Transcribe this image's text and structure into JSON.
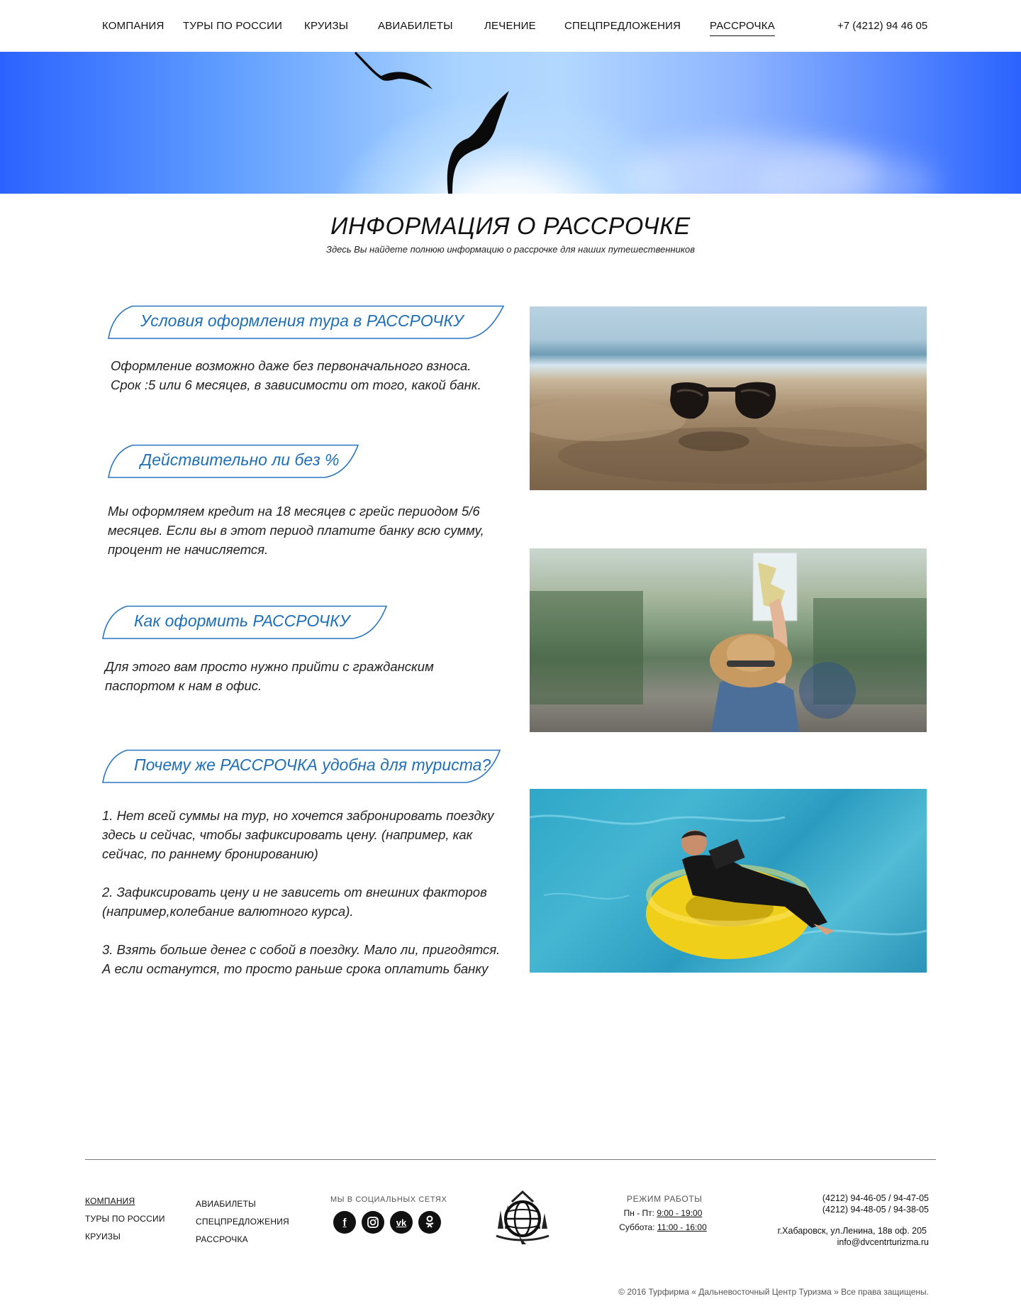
{
  "nav": {
    "items": [
      {
        "label": "КОМПАНИЯ"
      },
      {
        "label": "ТУРЫ ПО РОССИИ"
      },
      {
        "label": "КРУИЗЫ"
      },
      {
        "label": "АВИАБИЛЕТЫ"
      },
      {
        "label": "ЛЕЧЕНИЕ"
      },
      {
        "label": "СПЕЦПРЕДЛОЖЕНИЯ"
      },
      {
        "label": "РАССРОЧКА"
      }
    ],
    "active": "РАССРОЧКА",
    "phone": "+7 (4212) 94 46 05"
  },
  "page": {
    "title": "ИНФОРМАЦИЯ О РАССРОЧКЕ",
    "subtitle": "Здесь Вы найдете полнюю информацию о рассрочке для наших путешественников"
  },
  "sections": [
    {
      "heading": "Условия оформления тура в  РАССРОЧКУ",
      "text": "Оформление возможно даже без первоначального взноса.\nСрок :5 или 6 месяцев, в зависимости от того, какой банк."
    },
    {
      "heading": "Действительно ли без %",
      "text": "Мы оформляем кредит на 18 месяцев с грейс периодом 5/6\nмесяцев. Если вы в этот период платите банку всю сумму,\nпроцент не начисляется."
    },
    {
      "heading": "Как оформить РАССРОЧКУ",
      "text": " Для этого вам просто нужно прийти с гражданским\nпаспортом к нам в офис."
    },
    {
      "heading": "Почему же РАССРОЧКА удобна для туриста?",
      "text": "1. Нет всей суммы на тур, но хочется забронировать поездку\n здесь и сейчас, чтобы зафиксировать цену. (например, как\nсейчас, по раннему бронированию)\n\n2. Зафиксировать цену и не зависеть от внешних факторов\n(например,колебание валютного курса).\n\n3. Взять больше денег с собой в поездку. Мало ли, пригодятся.\nА если останутся, то просто раньше срока оплатить банку"
    }
  ],
  "photos": [
    "sunglasses-on-sand-photo",
    "traveler-with-map-photo",
    "businessman-on-pool-float-photo"
  ],
  "footer": {
    "col1": [
      "КОМПАНИЯ",
      "ТУРЫ ПО РОССИИ",
      "КРУИЗЫ"
    ],
    "col2": [
      "АВИАБИЛЕТЫ",
      "СПЕЦПРЕДЛОЖЕНИЯ",
      "РАССРОЧКА"
    ],
    "social_heading": "МЫ В СОЦИАЛЬНЫХ СЕТЯХ",
    "social_icons": [
      "facebook-icon",
      "instagram-icon",
      "vk-icon",
      "odnoklassniki-icon"
    ],
    "hours_heading": "РЕЖИМ РАБОТЫ",
    "hours": [
      {
        "day": "Пн - Пт:",
        "time": "9:00 - 19:00"
      },
      {
        "day": "Суббота:",
        "time": "11:00 - 16:00"
      }
    ],
    "phones": [
      "(4212) 94-46-05 / 94-47-05",
      "(4212) 94-48-05 / 94-38-05"
    ],
    "address": "г.Хабаровск, ул.Ленина, 18в оф. 205",
    "email": "info@dvcentrturizma.ru",
    "copyright": "© 2016 Турфирма « Дальневосточный Центр Туризма » Все права защищены."
  }
}
